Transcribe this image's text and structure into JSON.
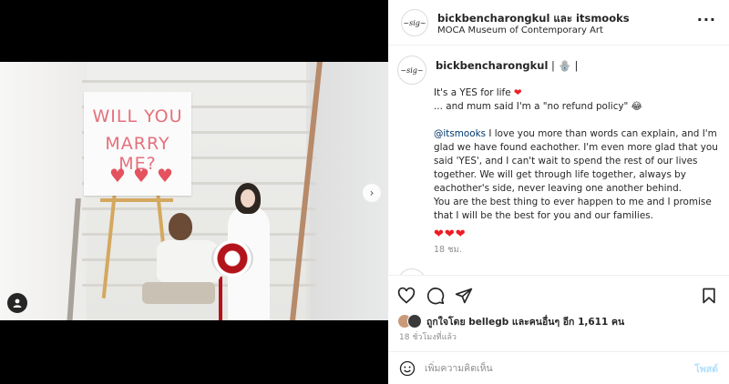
{
  "post": {
    "header_title": "bickbencharongkul และ itsmooks",
    "location": "MOCA Museum of Contemporary Art",
    "more_label": "···"
  },
  "photo": {
    "sign_lines": [
      "WILL YOU",
      "MARRY ME?"
    ],
    "carousel_dots": 4,
    "active_dot": 1
  },
  "caption": {
    "username": "bickbencharongkul",
    "username_suffix": " | 🪬 |",
    "line1": "It's a YES for life",
    "line1_heart": "❤",
    "line2": "... and mum said I'm a \"no refund policy\" 😂",
    "mention": "@itsmooks",
    "body": " I love you more than words can explain, and I'm glad we have found eachother. I'm even more glad that you said 'YES', and I can't wait to spend the rest of our lives together. We will get through life together, always by eachother's side, never leaving one another behind.",
    "body2": "You are the best thing to ever happen to me and I promise that I will be the best for you and our families.",
    "hearts": "❤❤❤",
    "time": "18 ชม."
  },
  "next_comment": {
    "username": "..."
  },
  "likes": {
    "text_prefix": "ถูกใจโดย",
    "liker": "bellegb",
    "text_mid": "และคนอื่นๆ อีก",
    "count": "1,611",
    "text_suffix": "คน"
  },
  "post_age": "18 ชั่วโมงที่แล้ว",
  "comment_box": {
    "placeholder": "เพิ่มความคิดเห็น",
    "post_label": "โพสต์"
  },
  "colors": {
    "link": "#00376b",
    "post_button_disabled": "#b2dffc",
    "muted": "#8e8e8e",
    "heart": "#ed1c24"
  }
}
